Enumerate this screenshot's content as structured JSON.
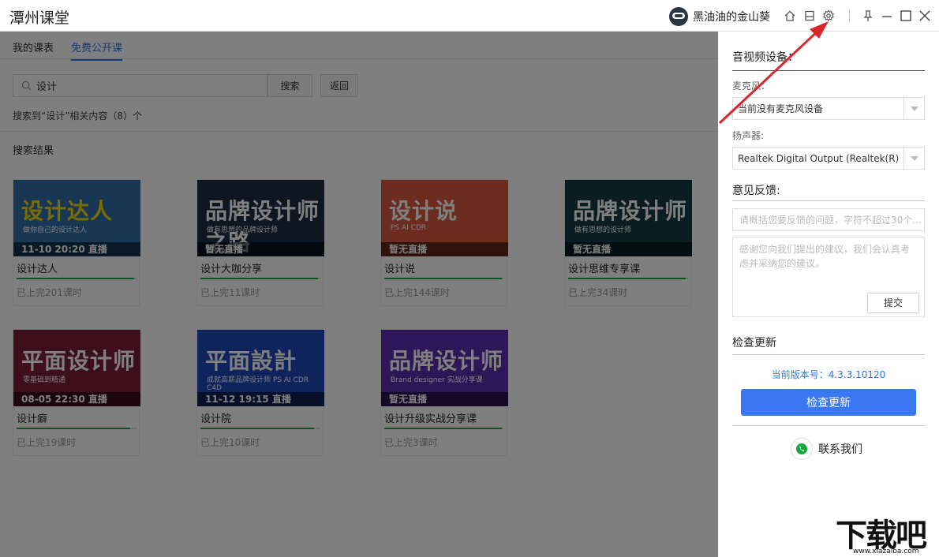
{
  "titlebar": {
    "app_title": "潭州课堂",
    "username": "黑油油的金山葵",
    "icons": [
      "user-avatar",
      "home-icon",
      "save-icon",
      "gear-icon",
      "pin-icon",
      "minimize-icon",
      "maximize-icon",
      "close-icon"
    ]
  },
  "tabs": [
    {
      "label": "我的课表",
      "active": false
    },
    {
      "label": "免费公开课",
      "active": true
    }
  ],
  "search": {
    "value": "设计",
    "search_button": "搜索",
    "back_button": "返回",
    "result_info": "搜索到“设计”相关内容（8）个",
    "results_heading": "搜索结果"
  },
  "courses": [
    {
      "thumb_title": "设计达人",
      "thumb_sub": "做你自己的设计达人",
      "status": "11-10 20:20 直播",
      "name": "设计达人",
      "lessons": "已上完201课时",
      "progress": 0.98,
      "color": "#2f6fa8"
    },
    {
      "thumb_title": "品牌设计师之路",
      "thumb_sub": "做有思想的品牌设计师",
      "status": "暂无直播",
      "name": "设计大咖分享",
      "lessons": "已上完11课时",
      "progress": 0.98,
      "color": "#1d2d44"
    },
    {
      "thumb_title": "设计说",
      "thumb_sub": "PS  AI  CDR",
      "status": "暂无直播",
      "name": "设计说",
      "lessons": "已上完144课时",
      "progress": 0.98,
      "color": "#d9583e"
    },
    {
      "thumb_title": "品牌设计师",
      "thumb_sub": "做有思想的设计师",
      "status": "暂无直播",
      "name": "设计思维专享课",
      "lessons": "已上完34课时",
      "progress": 0.98,
      "color": "#123a44"
    },
    {
      "thumb_title": "平面设计师",
      "thumb_sub": "零基础到精通",
      "status": "08-05 22:30 直播",
      "name": "设计癖",
      "lessons": "已上完19课时",
      "progress": 0.95,
      "color": "#7a1f3a"
    },
    {
      "thumb_title": "平面設計",
      "thumb_sub": "成就高薪品牌设计师 PS AI CDR C4D",
      "status": "11-12 19:15 直播",
      "name": "设计院",
      "lessons": "已上完10课时",
      "progress": 0.95,
      "color": "#1f46b8"
    },
    {
      "thumb_title": "品牌设计师",
      "thumb_sub": "Brand designer 实战分享课",
      "status": "暂无直播",
      "name": "设计升级实战分享课",
      "lessons": "已上完3课时",
      "progress": 0.98,
      "color": "#5a2fb0"
    }
  ],
  "panel": {
    "av_title": "音视频设备：",
    "mic_label": "麦克风：",
    "mic_value": "当前没有麦克风设备",
    "speaker_label": "扬声器:",
    "speaker_value": "Realtek Digital Output (Realtek(R) Au",
    "feedback_title": "意见反馈:",
    "feedback_placeholder": "请概括您要反馈的问题，字符不超过30个...",
    "feedback_text_placeholder": "感谢您向我们提出的建议，我们会认真考虑并采纳您的建议。",
    "submit_label": "提交",
    "update_title": "检查更新",
    "version": "当前版本号：4.3.3.10120",
    "update_button": "检查更新",
    "contact": "联系我们"
  },
  "watermark": {
    "text": "下载吧",
    "url": "www.xiazaiba.com"
  },
  "colors": {
    "accent": "#2a7ae2",
    "button_blue": "#3a78f2",
    "progress": "#19a63e",
    "annotation": "#d8282d"
  }
}
